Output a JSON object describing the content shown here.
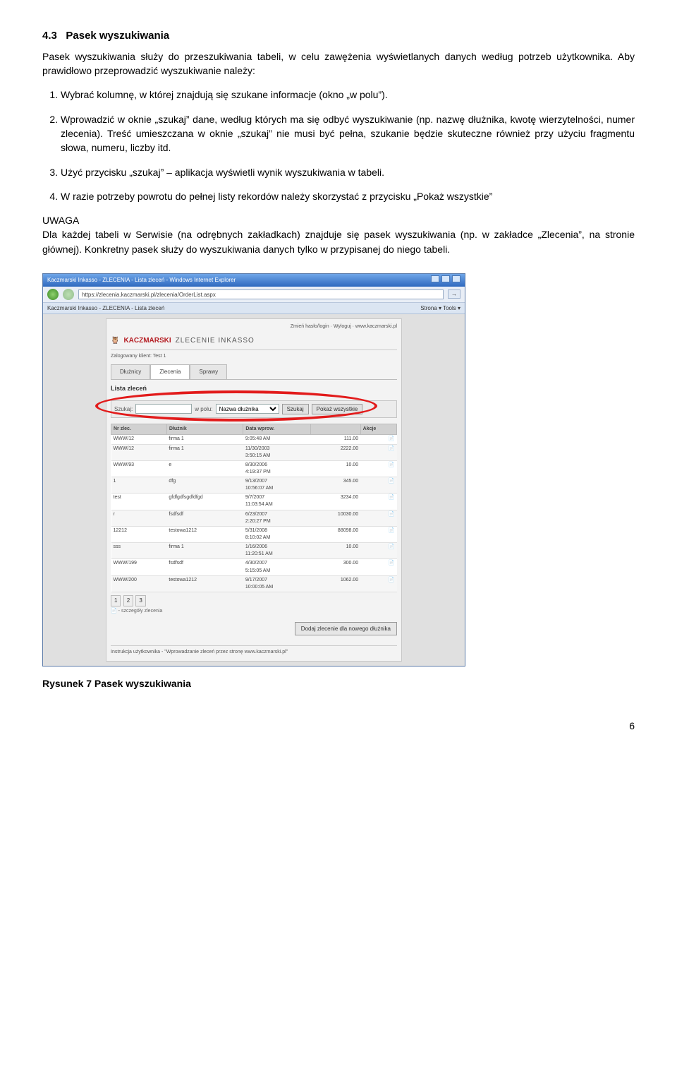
{
  "section": {
    "number": "4.3",
    "title": "Pasek wyszukiwania"
  },
  "intro": "Pasek wyszukiwania służy do przeszukiwania tabeli, w celu zawężenia wyświetlanych danych według potrzeb użytkownika. Aby prawidłowo przeprowadzić wyszukiwanie należy:",
  "list": {
    "i1": "Wybrać kolumnę, w której znajdują się szukane informacje (okno „w polu”).",
    "i2": "Wprowadzić w oknie „szukaj” dane, według których ma się odbyć wyszukiwanie (np. nazwę dłużnika, kwotę wierzytelności, numer zlecenia). Treść umieszczana w oknie „szukaj” nie musi być pełna, szukanie będzie skuteczne również przy użyciu fragmentu słowa, numeru, liczby itd.",
    "i3": "Użyć przycisku „szukaj” – aplikacja wyświetli wynik wyszukiwania w tabeli.",
    "i4": "W razie potrzeby powrotu do pełnej listy rekordów należy skorzystać z przycisku „Pokaż wszystkie”"
  },
  "uwaga": {
    "label": "UWAGA",
    "text": "Dla każdej tabeli w Serwisie (na odrębnych zakładkach) znajduje się pasek wyszukiwania (np. w zakładce „Zlecenia”, na stronie głównej). Konkretny pasek służy do wyszukiwania danych tylko w przypisanej do niego tabeli."
  },
  "screenshot": {
    "titlebar": "Kaczmarski Inkasso - ZLECENIA - Lista zleceń - Windows Internet Explorer",
    "address": "https://zlecenia.kaczmarski.pl/zlecenia/OrderList.aspx",
    "tab": "Kaczmarski Inkasso - ZLECENIA - Lista zleceń",
    "toolbar_right": "Strona ▾  Tools ▾",
    "top_right": "Zmień hasło/login · Wyloguj · www.kaczmarski.pl",
    "brand_name": "KACZMARSKI",
    "brand_title": "ZLECENIE INKASSO",
    "logged": "Zalogowany klient: Test 1",
    "tabs": {
      "t1": "Dłużnicy",
      "t2": "Zlecenia",
      "t3": "Sprawy"
    },
    "list_title": "Lista zleceń",
    "search": {
      "label_szukaj": "Szukaj:",
      "label_wpolu": "w polu:",
      "select_value": "Nazwa dłużnika",
      "btn_szukaj": "Szukaj",
      "btn_all": "Pokaż wszystkie"
    },
    "columns": {
      "c1": "Nr zlec.",
      "c2": "Dłużnik",
      "c3": "Data wprow.",
      "c4": "",
      "c5": "Akcje"
    },
    "rows": [
      {
        "nr": "WWW/12",
        "dl": "firma 1",
        "d1": "9:05:48 AM",
        "d2": "",
        "kw": "111.00"
      },
      {
        "nr": "WWW/12",
        "dl": "firma 1",
        "d1": "11/30/2003",
        "d2": "3:50:15 AM",
        "kw": "2222.00"
      },
      {
        "nr": "WWW/93",
        "dl": "e",
        "d1": "8/30/2006",
        "d2": "4:19:37 PM",
        "kw": "10.00"
      },
      {
        "nr": "1",
        "dl": "dfg",
        "d1": "9/13/2007",
        "d2": "10:56:07 AM",
        "kw": "345.00"
      },
      {
        "nr": "test",
        "dl": "gfdfgdfsgdfdfgd",
        "d1": "9/7/2007",
        "d2": "11:03:54 AM",
        "kw": "3234.00"
      },
      {
        "nr": "r",
        "dl": "fsdfsdf",
        "d1": "6/23/2007",
        "d2": "2:20:27 PM",
        "kw": "10030.00"
      },
      {
        "nr": "12212",
        "dl": "testowa1212",
        "d1": "5/31/2008",
        "d2": "8:10:02 AM",
        "kw": "88098.00"
      },
      {
        "nr": "sss",
        "dl": "firma 1",
        "d1": "1/16/2006",
        "d2": "11:20:51 AM",
        "kw": "10.00"
      },
      {
        "nr": "WWW/199",
        "dl": "fsdfsdf",
        "d1": "4/30/2007",
        "d2": "5:15:05 AM",
        "kw": "300.00"
      },
      {
        "nr": "WWW/200",
        "dl": "testowa1212",
        "d1": "9/17/2007",
        "d2": "10:00:05 AM",
        "kw": "1062.00"
      }
    ],
    "pager": {
      "p1": "1",
      "p2": "2",
      "p3": "3"
    },
    "pager_note": " - szczegóły zlecenia",
    "big_button": "Dodaj zlecenie dla nowego dłużnika",
    "instruction": "Instrukcja użytkownika - \"Wprowadzanie zleceń przez stronę www.kaczmarski.pl\""
  },
  "caption": "Rysunek 7 Pasek wyszukiwania",
  "page_number": "6"
}
